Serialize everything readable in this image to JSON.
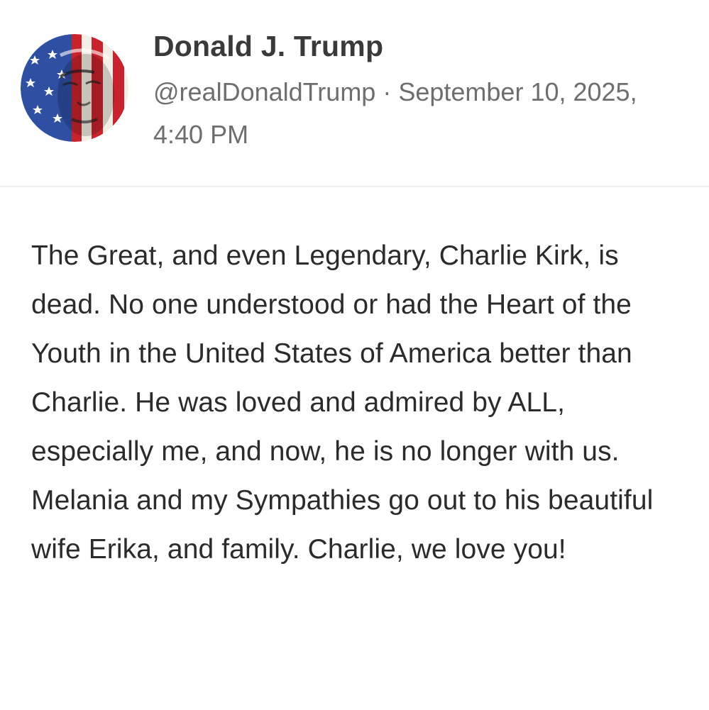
{
  "post": {
    "author": {
      "display_name": "Donald J. Trump",
      "handle": "@realDonaldTrump",
      "avatar_icon": "flag-portrait-avatar-icon"
    },
    "separator": " · ",
    "timestamp": "September 10, 2025, 4:40 PM",
    "text": "The Great, and even Legendary, Charlie Kirk, is dead. No one understood or had the Heart of the Youth in the United States of America better than Charlie. He was loved and admired by ALL, especially me, and now, he is no longer with us. Melania and my Sympathies go out to his beautiful wife Erika, and family. Charlie, we love you!"
  },
  "colors": {
    "background": "#ffffff",
    "name_text": "#3a3a3a",
    "meta_text": "#6e6e6e",
    "body_text": "#2b2b2b",
    "divider": "#ededed",
    "flag_red": "#c8232c",
    "flag_blue": "#2f4fa3"
  }
}
